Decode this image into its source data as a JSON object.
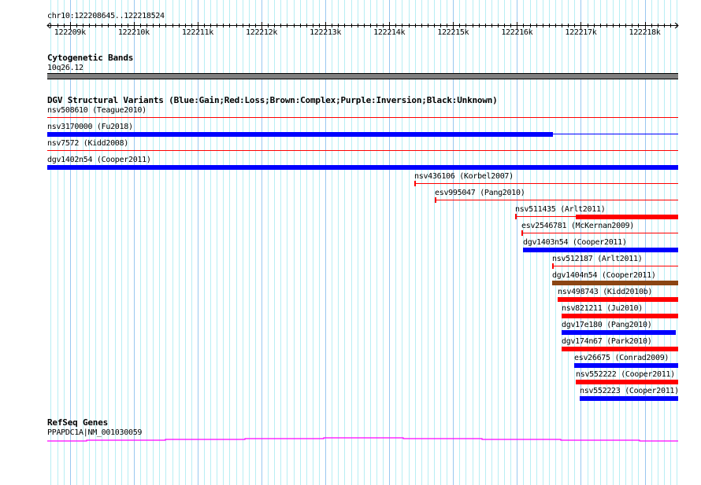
{
  "ruler": {
    "location": "chr10:122208645..122218524",
    "view_start": 122208645,
    "view_end": 122218524,
    "tick_labels": [
      "122209k",
      "122210k",
      "122211k",
      "122212k",
      "122213k",
      "122214k",
      "122215k",
      "122216k",
      "122217k",
      "122218k"
    ]
  },
  "cytoband": {
    "title": "Cytogenetic Bands",
    "band": "10q26.12",
    "color": "#808080"
  },
  "dgv": {
    "title": "DGV Structural Variants (Blue:Gain;Red:Loss;Brown:Complex;Purple:Inversion;Black:Unknown)",
    "features": [
      {
        "label": "nsv508610 (Teague2010)",
        "color": "#ff0000",
        "start": 122208645,
        "end": 122218524,
        "thick_start": null,
        "thick_end": null,
        "start_tick": false
      },
      {
        "label": "nsv3170000 (Fu2018)",
        "color": "#0000ff",
        "start": 122208645,
        "end": 122218524,
        "thick_start": 122208645,
        "thick_end": 122216563,
        "start_tick": false
      },
      {
        "label": "nsv7572 (Kidd2008)",
        "color": "#ff0000",
        "start": 122208645,
        "end": 122218524,
        "thick_start": null,
        "thick_end": null,
        "start_tick": false
      },
      {
        "label": "dgv1402n54 (Cooper2011)",
        "color": "#0000ff",
        "start": 122208645,
        "end": 122218524,
        "thick_start": 122208645,
        "thick_end": 122218524,
        "start_tick": false
      },
      {
        "label": "nsv436106 (Korbel2007)",
        "color": "#ff0000",
        "start": 122214392,
        "end": 122218524,
        "thick_start": null,
        "thick_end": null,
        "start_tick": true
      },
      {
        "label": "esv995047 (Pang2010)",
        "color": "#ff0000",
        "start": 122214713,
        "end": 122218524,
        "thick_start": null,
        "thick_end": null,
        "start_tick": true
      },
      {
        "label": "nsv511435 (Arlt2011)",
        "color": "#ff0000",
        "start": 122215971,
        "end": 122218524,
        "thick_start": 122216921,
        "thick_end": 122218524,
        "start_tick": true
      },
      {
        "label": "esv2546781 (McKernan2009)",
        "color": "#ff0000",
        "start": 122216069,
        "end": 122218524,
        "thick_start": null,
        "thick_end": null,
        "start_tick": true
      },
      {
        "label": "dgv1403n54 (Cooper2011)",
        "color": "#0000ff",
        "start": 122216094,
        "end": 122218524,
        "thick_start": 122216094,
        "thick_end": 122218524,
        "start_tick": false
      },
      {
        "label": "nsv512187 (Arlt2011)",
        "color": "#ff0000",
        "start": 122216550,
        "end": 122218524,
        "thick_start": null,
        "thick_end": null,
        "start_tick": true
      },
      {
        "label": "dgv1404n54 (Cooper2011)",
        "color": "#8b4513",
        "start": 122216550,
        "end": 122218524,
        "thick_start": 122216550,
        "thick_end": 122218524,
        "start_tick": false
      },
      {
        "label": "nsv498743 (Kidd2010b)",
        "color": "#ff0000",
        "start": 122216637,
        "end": 122218524,
        "thick_start": 122216637,
        "thick_end": 122218524,
        "start_tick": false
      },
      {
        "label": "nsv821211 (Ju2010)",
        "color": "#ff0000",
        "start": 122216698,
        "end": 122218524,
        "thick_start": 122216698,
        "thick_end": 122218524,
        "start_tick": false
      },
      {
        "label": "dgv17e180 (Pang2010)",
        "color": "#0000ff",
        "start": 122216698,
        "end": 122218487,
        "thick_start": 122216698,
        "thick_end": 122218487,
        "start_tick": false
      },
      {
        "label": "dgv174n67 (Park2010)",
        "color": "#ff0000",
        "start": 122216698,
        "end": 122218524,
        "thick_start": 122216698,
        "thick_end": 122218524,
        "start_tick": false
      },
      {
        "label": "esv26675 (Conrad2009)",
        "color": "#0000ff",
        "start": 122216896,
        "end": 122218524,
        "thick_start": 122216896,
        "thick_end": 122218524,
        "start_tick": false
      },
      {
        "label": "nsv552222 (Cooper2011)",
        "color": "#ff0000",
        "start": 122216921,
        "end": 122218524,
        "thick_start": 122216921,
        "thick_end": 122218524,
        "start_tick": false
      },
      {
        "label": "nsv552223 (Cooper2011)",
        "color": "#0000ff",
        "start": 122216982,
        "end": 122218524,
        "thick_start": 122216982,
        "thick_end": 122218524,
        "start_tick": false
      }
    ]
  },
  "refseq": {
    "title": "RefSeq Genes",
    "gene": "PPAPDC1A|NM_001030059",
    "color": "#ff00ff"
  }
}
